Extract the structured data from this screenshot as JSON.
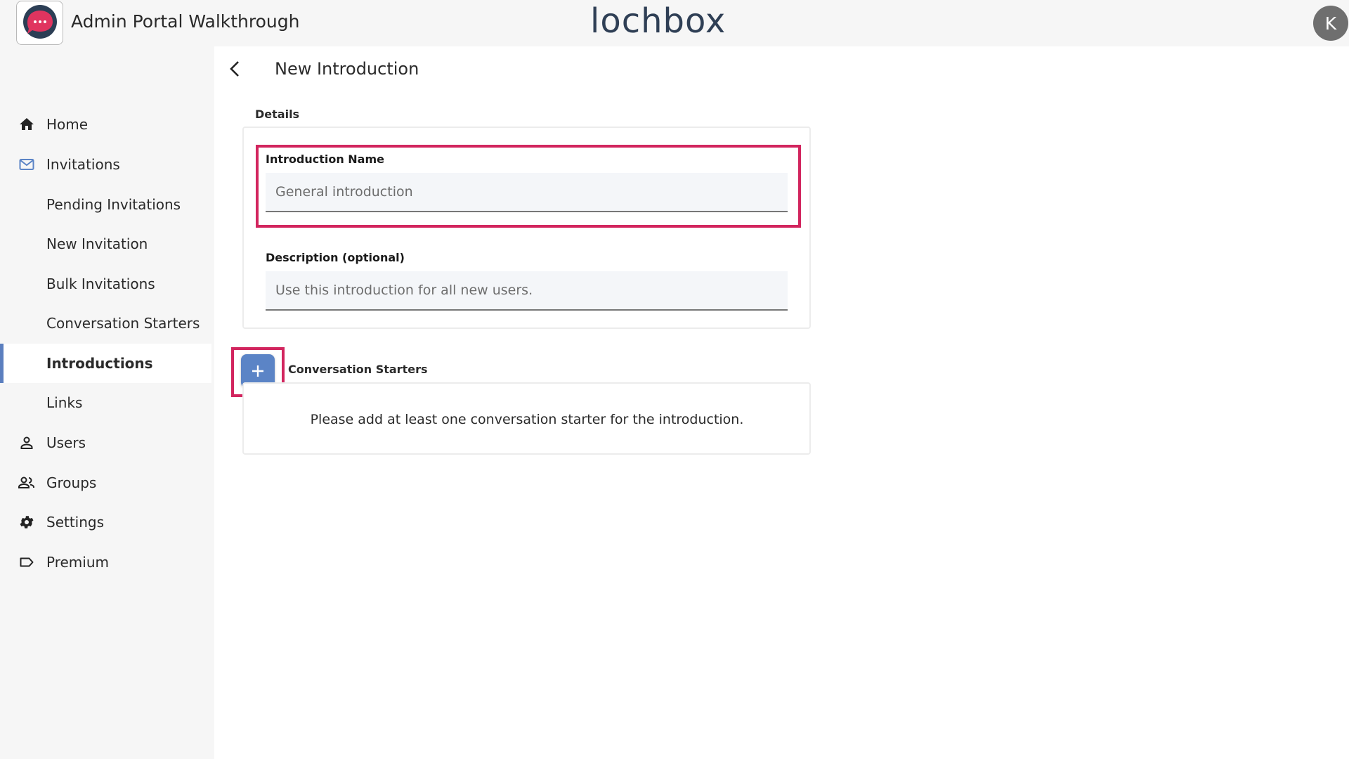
{
  "header": {
    "app_title": "Admin Portal Walkthrough",
    "brand": "lochbox",
    "avatar_initial": "K"
  },
  "sidebar": {
    "items": [
      {
        "label": "Home",
        "icon": "home-icon"
      },
      {
        "label": "Invitations",
        "icon": "mail-icon"
      },
      {
        "label": "Pending Invitations",
        "icon": ""
      },
      {
        "label": "New Invitation",
        "icon": ""
      },
      {
        "label": "Bulk Invitations",
        "icon": ""
      },
      {
        "label": "Conversation Starters",
        "icon": ""
      },
      {
        "label": "Introductions",
        "icon": "",
        "active": true
      },
      {
        "label": "Links",
        "icon": ""
      },
      {
        "label": "Users",
        "icon": "user-icon"
      },
      {
        "label": "Groups",
        "icon": "group-icon"
      },
      {
        "label": "Settings",
        "icon": "gear-icon"
      },
      {
        "label": "Premium",
        "icon": "label-icon"
      }
    ]
  },
  "main": {
    "title": "New Introduction",
    "details_label": "Details",
    "name_field": {
      "label": "Introduction Name",
      "placeholder": "General introduction"
    },
    "description_field": {
      "label": "Description (optional)",
      "placeholder": "Use this introduction for all new users."
    },
    "starters_label": "Conversation Starters",
    "starters_empty": "Please add at least one conversation starter for the introduction.",
    "add_symbol": "+"
  },
  "colors": {
    "accent": "#5b84c6",
    "highlight": "#d2255e",
    "active_bar": "#5b7fbf",
    "sidebar_bg": "#f6f6f6"
  }
}
